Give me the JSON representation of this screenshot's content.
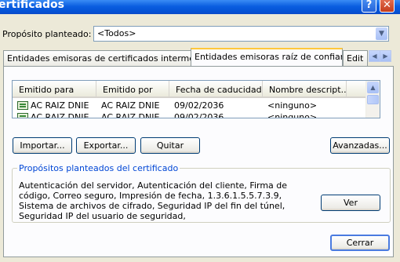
{
  "window": {
    "title": "ertificados",
    "help_glyph": "?",
    "close_glyph": "✕"
  },
  "purpose": {
    "label": "Propósito planteado:",
    "value": "<Todos>"
  },
  "tabs": [
    {
      "label": "Entidades emisoras de certificados intermedias"
    },
    {
      "label": "Entidades emisoras raíz de confianza"
    },
    {
      "label": "Edit"
    }
  ],
  "list": {
    "columns": [
      "Emitido para",
      "Emitido por",
      "Fecha de caducidad",
      "Nombre descript..."
    ],
    "rows": [
      {
        "issued_to": "AC RAIZ DNIE",
        "issued_by": "AC RAIZ DNIE",
        "expiry": "09/02/2036",
        "friendly": "<ninguno>"
      },
      {
        "issued_to": "AC RAIZ DNIE",
        "issued_by": "AC RAIZ DNIE",
        "expiry": "09/02/2036",
        "friendly": "<ninguno>"
      }
    ]
  },
  "buttons": {
    "import": "Importar...",
    "export": "Exportar...",
    "remove": "Quitar",
    "advanced": "Avanzadas...",
    "view": "Ver",
    "close": "Cerrar"
  },
  "purposes_group": {
    "title": "Propósitos planteados del certificado",
    "text": "Autenticación del servidor, Autenticación del cliente, Firma de código, Correo seguro, Impresión de fecha, 1.3.6.1.5.5.7.3.9, Sistema de archivos de cifrado, Seguridad IP del fin del túnel, Seguridad IP del usuario de seguridad,"
  }
}
